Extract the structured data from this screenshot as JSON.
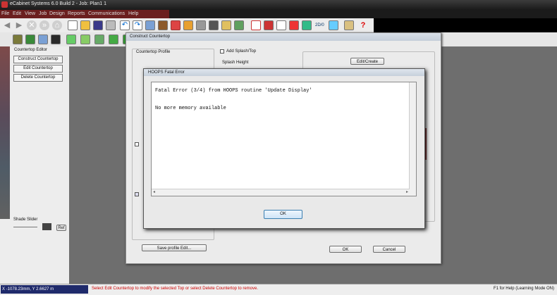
{
  "window": {
    "title": "eCabinet Systems 6.0 Build 2 - Job: Plan1 1"
  },
  "menu": [
    "File",
    "Edit",
    "View",
    "Job",
    "Design",
    "Reports",
    "Communications",
    "Help"
  ],
  "toolbar1": {
    "icons": [
      "back-arrow",
      "forward-arrow",
      "stop",
      "refresh",
      "new",
      "open",
      "save",
      "print",
      "undo",
      "redo",
      "cabinet",
      "construction",
      "mirror",
      "dimensions",
      "tool-a",
      "tool-b",
      "library",
      "tool-c",
      "tool-d",
      "tool-e",
      "tool-f",
      "tool-g",
      "tool-h",
      "tool-i",
      "help"
    ],
    "code_label": "2D/0"
  },
  "toolbar2": {
    "icons": [
      "view-1",
      "view-2",
      "view-3",
      "view-4",
      "view-5",
      "view-6",
      "view-7",
      "view-8",
      "view-9",
      "view-10",
      "view-11",
      "view-12",
      "view-13"
    ]
  },
  "left_panel": {
    "section_title": "Countertop Editor",
    "buttons": [
      "Construct Countertop",
      "Edit Countertop",
      "Delete Countertop"
    ],
    "shade": {
      "label": "Shade Slider",
      "button": "Ref"
    }
  },
  "construct_dialog": {
    "title": "Construct Countertop",
    "group1_label": "Countertop Profile",
    "group2_label": "Edge Profile",
    "add_backsplash_label": "Add Splash/Top",
    "add_backsplash_checked": false,
    "field_label": "Splash Height",
    "btn_top_right": "Edit/Create",
    "btn_bottom_left": "Save profile Edit...",
    "ok": "OK",
    "cancel": "Cancel"
  },
  "error_dialog": {
    "title": "HOOPS Fatal Error",
    "line1": "Fatal Error (3/4) from HOOPS routine 'Update Display'",
    "line2": "No more memory available",
    "ok": "OK"
  },
  "status": {
    "coords": "X -1078.23mm, Y 2.6627 m",
    "tip": "Select Edit Countertop to modify the selected Top or select Delete Countertop to remove.",
    "help": "F1 for Help (Learning Mode ON)"
  },
  "colors": {
    "error_tip": "#cc0000",
    "coord_bg": "#1f2a6b",
    "ok_border": "#3c7fb1"
  }
}
